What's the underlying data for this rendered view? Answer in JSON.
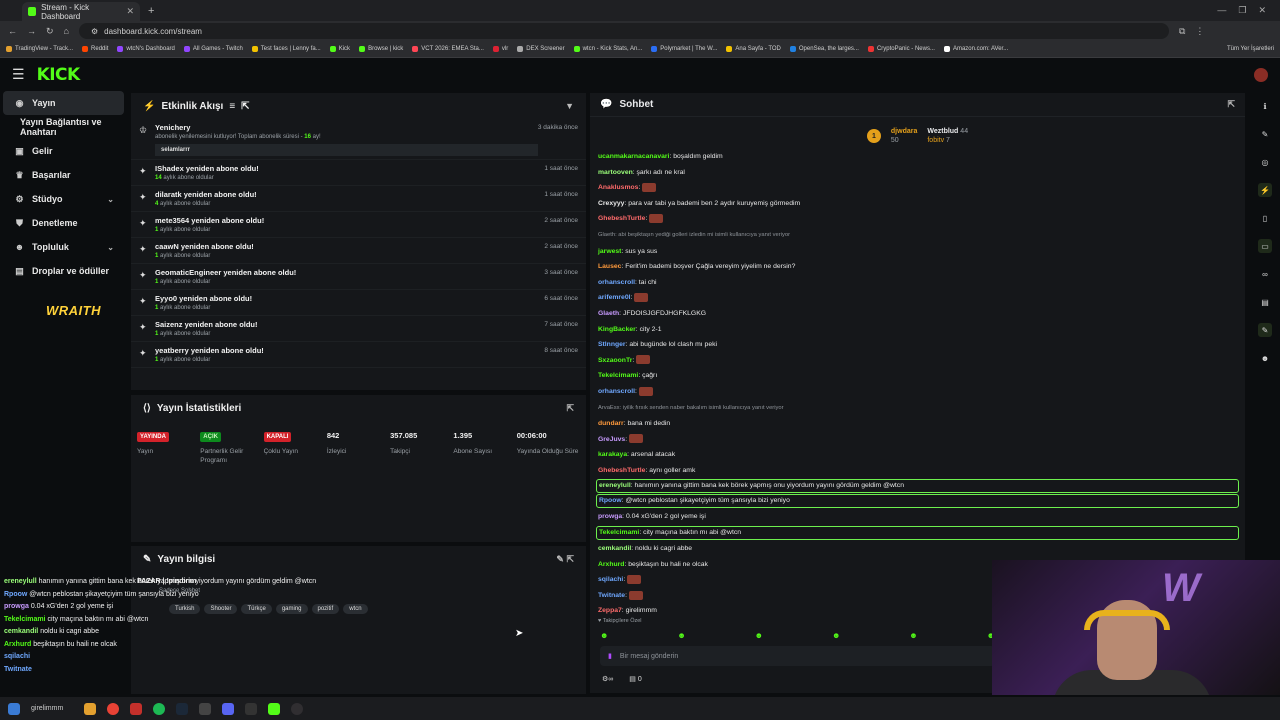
{
  "browser": {
    "tab_title": "Stream - Kick Dashboard",
    "url": "dashboard.kick.com/stream",
    "bookmarks": [
      "TradingView - Track...",
      "Reddit",
      "wtcN's Dashboard",
      "All Games - Twitch",
      "Test faces | Lenny fa...",
      "Kick",
      "Browse | kick",
      "VCT 2026: EMEA Sta...",
      "vlr",
      "DEX Screener",
      "wtcn - Kick Stats, An...",
      "Polymarket | The W...",
      "Ana Sayfa - TOD",
      "OpenSea, the larges...",
      "CryptoPanic - News...",
      "Amazon.com: AVer..."
    ],
    "bookmarks_end": "Tüm Yer İşaretleri"
  },
  "app": {
    "logo": "KICK"
  },
  "sidebar": {
    "items": [
      {
        "label": "Yayın",
        "icon": "broadcast-icon"
      },
      {
        "label": "Yayın Bağlantısı ve Anahtarı",
        "icon": ""
      },
      {
        "label": "Gelir",
        "icon": "money-icon"
      },
      {
        "label": "Başarılar",
        "icon": "trophy-icon"
      },
      {
        "label": "Stüdyo",
        "icon": "studio-icon"
      },
      {
        "label": "Denetleme",
        "icon": "shield-icon"
      },
      {
        "label": "Topluluk",
        "icon": "community-icon"
      },
      {
        "label": "Droplar ve ödüller",
        "icon": "gift-icon"
      }
    ],
    "sponsor": "WRAITH"
  },
  "activity": {
    "title": "Etkinlik Akışı",
    "first": {
      "user": "Yenichery",
      "text": "abonelik yenilemesini kutluyor! Toplam abonelik süresi - ",
      "months": "16",
      "months_suffix": " ay!",
      "message": "selamlarrr",
      "time": "3 dakika önce"
    },
    "items": [
      {
        "title": "IShadex yeniden abone oldu!",
        "months": "14",
        "sub": " aylık abone oldular",
        "time": "1 saat önce"
      },
      {
        "title": "dilaratk yeniden abone oldu!",
        "months": "4",
        "sub": " aylık abone oldular",
        "time": "1 saat önce"
      },
      {
        "title": "mete3564 yeniden abone oldu!",
        "months": "1",
        "sub": " aylık abone oldular",
        "time": "2 saat önce"
      },
      {
        "title": "caawN yeniden abone oldu!",
        "months": "1",
        "sub": " aylık abone oldular",
        "time": "2 saat önce"
      },
      {
        "title": "GeomaticEngineer yeniden abone oldu!",
        "months": "1",
        "sub": " aylık abone oldular",
        "time": "3 saat önce"
      },
      {
        "title": "Eyyo0 yeniden abone oldu!",
        "months": "1",
        "sub": " aylık abone oldular",
        "time": "6 saat önce"
      },
      {
        "title": "Saizenz yeniden abone oldu!",
        "months": "1",
        "sub": " aylık abone oldular",
        "time": "7 saat önce"
      },
      {
        "title": "yeatberry yeniden abone oldu!",
        "months": "1",
        "sub": " aylık abone oldular",
        "time": "8 saat önce"
      }
    ]
  },
  "stats": {
    "title": "Yayın İstatistikleri",
    "cells": [
      {
        "badge": "YAYINDA",
        "badge_color": "red",
        "label": "Yayın"
      },
      {
        "badge": "AÇIK",
        "badge_color": "green",
        "label": "Partnerlik Gelir Programı"
      },
      {
        "badge": "KAPALI",
        "badge_color": "red",
        "label": "Çoklu Yayın"
      },
      {
        "value": "842",
        "label": "İzleyici"
      },
      {
        "value": "357.085",
        "label": "Takipçi"
      },
      {
        "value": "1.395",
        "label": "Abone Sayısı"
      },
      {
        "value": "00:06:00",
        "label": "Yayında Olduğu Süre"
      }
    ]
  },
  "info": {
    "title": "Yayın bilgisi",
    "stream_title": "PAZAR | !pindirim",
    "category_hint": "Sadece Sohbet",
    "tags": [
      "Turkish",
      "Shooter",
      "Türkçe",
      "gaming",
      "pozitif",
      "wtcn"
    ]
  },
  "overlay_chat": [
    {
      "user": "ereneylull",
      "color": "#9bff7a",
      "text": "hanımın yanına gittim bana kek börek yapmış onu yiyordum yayını gördüm geldim @wtcn"
    },
    {
      "user": "Rpoow",
      "color": "#6fa8ff",
      "text": "@wtcn peblostan şikayetçiyim tüm şansıyla bizi yeniyo"
    },
    {
      "user": "prowga",
      "color": "#c89bff",
      "text": "0.04 xG'den 2 gol yeme işi"
    },
    {
      "user": "Tekelcimami",
      "color": "#53fc18",
      "text": "city maçına baktın mı abi @wtcn"
    },
    {
      "user": "cemkandil",
      "color": "#9bff7a",
      "text": "noldu ki cagri abbe"
    },
    {
      "user": "Arxhurd",
      "color": "#53fc18",
      "text": "beşiktaşın bu haili ne olcak"
    },
    {
      "user": "sqilachi",
      "color": "#6fa8ff",
      "text": ""
    },
    {
      "user": "Twitnate",
      "color": "#6fa8ff",
      "text": ""
    }
  ],
  "chat": {
    "title": "Sohbet",
    "pinned": [
      {
        "rank": "1",
        "user": "djwdara",
        "count": "50"
      },
      {
        "user": "Weztblud",
        "count": "44"
      },
      {
        "user": "fobitv",
        "count": "7"
      }
    ],
    "messages": [
      {
        "user": "ucanmakarnacanavari",
        "color": "#53fc18",
        "text": "boşaldım geldim"
      },
      {
        "user": "martooven",
        "color": "#9bff7a",
        "text": "şarkı adı ne kral"
      },
      {
        "user": "Anaklusmos",
        "color": "#ff6b6b",
        "text": ""
      },
      {
        "user": "Crexyyy",
        "color": "#e9e9e9",
        "text": "para var tabi ya bademi ben 2 aydır kuruyemiş görmedim"
      },
      {
        "user": "GhebeshTurtle",
        "color": "#ff6b6b",
        "text": ""
      },
      {
        "reply": "Glaeth: abi beşiktaşın yediği golleri izledin mi isimli kullanıcıya yanıt veriyor"
      },
      {
        "user": "jarwest",
        "color": "#53fc18",
        "text": "sus ya sus"
      },
      {
        "user": "Lausec",
        "color": "#ff9a3c",
        "text": "Ferit'im bademi boşver Çağla vereyim yiyelim ne dersin?"
      },
      {
        "user": "orhanscroll",
        "color": "#6fa8ff",
        "text": "tai chi"
      },
      {
        "user": "arifemre0l",
        "color": "#6fa8ff",
        "text": ""
      },
      {
        "user": "Glaeth",
        "color": "#c89bff",
        "text": "JFDOISJGFDJHGFKLGKG"
      },
      {
        "user": "KingBacker",
        "color": "#53fc18",
        "text": "city 2-1"
      },
      {
        "user": "Stlnnger",
        "color": "#6fa8ff",
        "text": "abi bugünde lol clash mı peki"
      },
      {
        "user": "SxzaoonTr",
        "color": "#53fc18",
        "text": ""
      },
      {
        "user": "Tekelcimami",
        "color": "#53fc18",
        "text": "çağrı"
      },
      {
        "user": "orhanscroll",
        "color": "#6fa8ff",
        "text": ""
      },
      {
        "reply": "ArvaEsx: iyilik fırsık senden naber bakalım isimli kullanıcıya yanıt veriyor"
      },
      {
        "user": "dundarr",
        "color": "#ff9a3c",
        "text": "bana mi dedin"
      },
      {
        "user": "GreJuvs",
        "color": "#c89bff",
        "text": ""
      },
      {
        "user": "karakaya",
        "color": "#53fc18",
        "text": "arsenal atacak"
      },
      {
        "user": "GhebeshTurtle",
        "color": "#ff6b6b",
        "text": "aynı goller amk"
      },
      {
        "user": "ereneylull",
        "color": "#9bff7a",
        "text": "hanımın yanına gittim bana kek börek yapmış onu yiyordum yayını gördüm geldim @wtcn",
        "highlight": true
      },
      {
        "user": "Rpoow",
        "color": "#6fa8ff",
        "text": "@wtcn peblostan şikayetçiyim tüm şansıyla bizi yeniyo",
        "highlight": true
      },
      {
        "user": "prowga",
        "color": "#c89bff",
        "text": "0.04 xG'den 2 gol yeme işi"
      },
      {
        "user": "Tekelcimami",
        "color": "#53fc18",
        "text": "city maçına baktın mı abi @wtcn",
        "highlight": true
      },
      {
        "user": "cemkandil",
        "color": "#9bff7a",
        "text": "noldu ki cagri abbe"
      },
      {
        "user": "Arxhurd",
        "color": "#53fc18",
        "text": "beşiktaşın bu hali ne olcak"
      },
      {
        "user": "sqilachi",
        "color": "#6fa8ff",
        "text": ""
      },
      {
        "user": "Twitnate",
        "color": "#6fa8ff",
        "text": ""
      },
      {
        "user": "Zeppa7",
        "color": "#ff6b6b",
        "text": "girelimmm"
      }
    ],
    "follow_hint": "Takipçilere Özel",
    "input_placeholder": "Bir mesaj gönderin",
    "footer_count": "0"
  },
  "taskbar": {
    "search_text": "girelimmm"
  }
}
